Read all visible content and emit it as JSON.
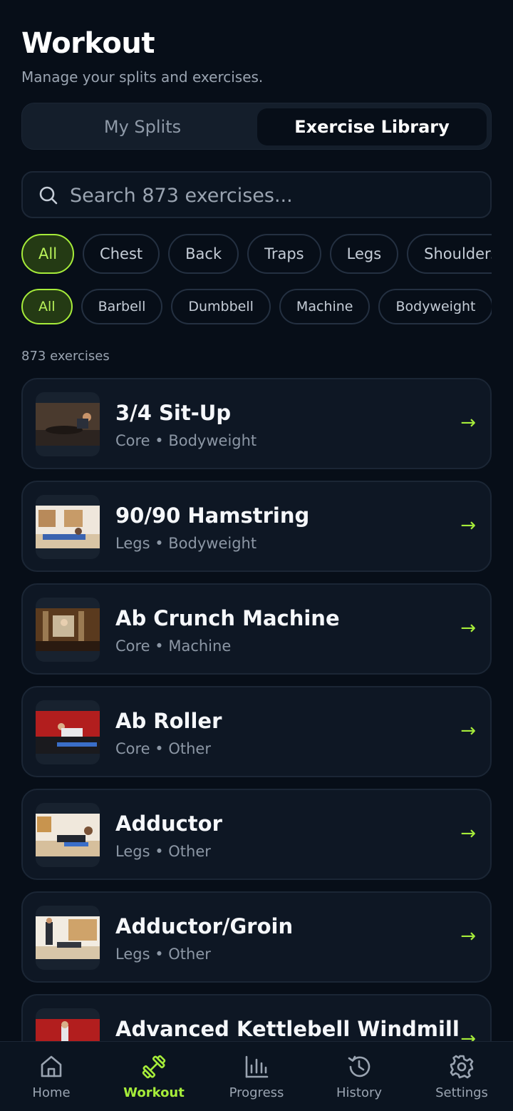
{
  "header": {
    "title": "Workout",
    "subtitle": "Manage your splits and exercises."
  },
  "tabs": {
    "my_splits": "My Splits",
    "exercise_library": "Exercise Library",
    "selected": "Exercise Library"
  },
  "search": {
    "placeholder": "Search 873 exercises..."
  },
  "muscle_filters": {
    "items": [
      "All",
      "Chest",
      "Back",
      "Traps",
      "Legs",
      "Shoulders"
    ],
    "selected": "All"
  },
  "equipment_filters": {
    "items": [
      "All",
      "Barbell",
      "Dumbbell",
      "Machine",
      "Bodyweight"
    ],
    "selected": "All"
  },
  "result_count": "873 exercises",
  "exercises": [
    {
      "name": "3/4 Sit-Up",
      "meta": "Core • Bodyweight"
    },
    {
      "name": "90/90 Hamstring",
      "meta": "Legs • Bodyweight"
    },
    {
      "name": "Ab Crunch Machine",
      "meta": "Core • Machine"
    },
    {
      "name": "Ab Roller",
      "meta": "Core • Other"
    },
    {
      "name": "Adductor",
      "meta": "Legs • Other"
    },
    {
      "name": "Adductor/Groin",
      "meta": "Legs • Other"
    },
    {
      "name": "Advanced Kettlebell Windmill",
      "meta": ""
    }
  ],
  "card_arrow": "→",
  "nav": {
    "home": "Home",
    "workout": "Workout",
    "progress": "Progress",
    "history": "History",
    "settings": "Settings",
    "active": "Workout"
  },
  "colors": {
    "accent": "#a6ec3a",
    "background": "#070e18",
    "card": "#0e1724"
  }
}
